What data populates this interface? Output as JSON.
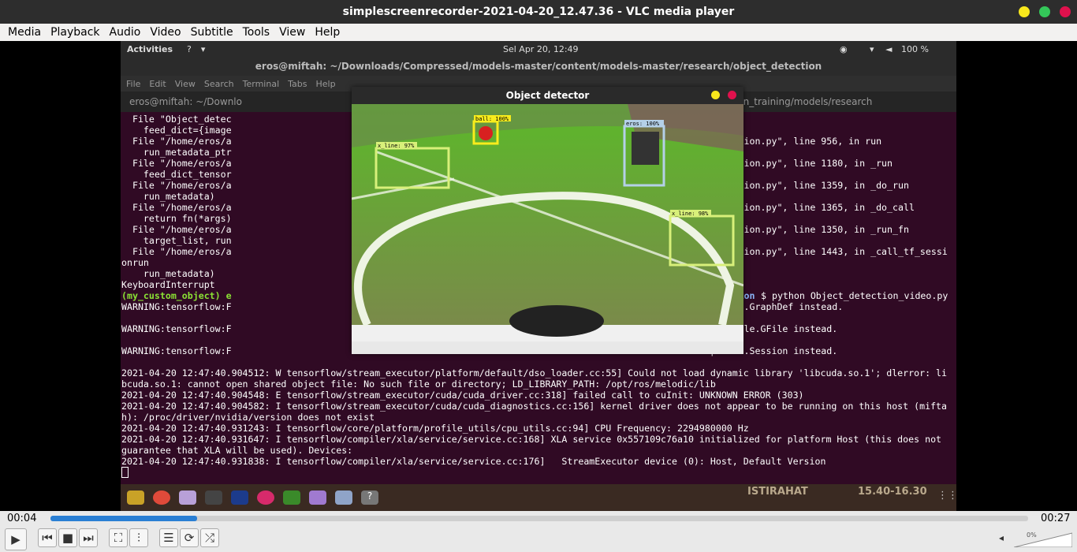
{
  "window": {
    "title": "simplescreenrecorder-2021-04-20_12.47.36 - VLC media player",
    "colors": {
      "minimize": "#f8e71c",
      "maximize": "#34c759",
      "close": "#e0114d"
    }
  },
  "menu": [
    "Media",
    "Playback",
    "Audio",
    "Video",
    "Subtitle",
    "Tools",
    "View",
    "Help"
  ],
  "desktop": {
    "activities": "Activities",
    "help": "?",
    "clock": "Sel Apr 20, 12:49",
    "battery": "100 %"
  },
  "terminal": {
    "title": "eros@miftah: ~/Downloads/Compressed/models-master/content/models-master/research/object_detection",
    "menu": [
      "File",
      "Edit",
      "View",
      "Search",
      "Terminal",
      "Tabs",
      "Help"
    ],
    "tab1": "eros@miftah: ~/Downlo",
    "tab2": "miftah: ~/code/eros_vision_training/models/research",
    "left_lines": [
      "  File \"Object_detec",
      "    feed_dict={image",
      "  File \"/home/eros/a",
      "    run_metadata_ptr",
      "  File \"/home/eros/a",
      "    feed_dict_tensor",
      "  File \"/home/eros/a",
      "    run_metadata)",
      "  File \"/home/eros/a",
      "    return fn(*args)",
      "  File \"/home/eros/a",
      "    target_list, run",
      "  File \"/home/eros/a",
      "onrun",
      "    run_metadata)",
      "KeyboardInterrupt",
      "(my_custom_object) e",
      "WARNING:tensorflow:F",
      "",
      "WARNING:tensorflow:F",
      "",
      "WARNING:tensorflow:F"
    ],
    "right_lines": [
      "",
      "",
      "ore/python/client/session.py\", line 956, in run",
      "",
      "ore/python/client/session.py\", line 1180, in _run",
      "",
      "ore/python/client/session.py\", line 1359, in _do_run",
      "",
      "ore/python/client/session.py\", line 1365, in _do_call",
      "",
      "ore/python/client/session.py\", line 1350, in _run_fn",
      "",
      "ore/python/client/session.py\", line 1443, in _call_tf_sessi",
      "",
      "",
      "",
      "esearch/object_detection",
      "lease use tf.compat.v1.GraphDef instead.",
      "",
      ". Please use tf.io.gfile.GFile instead.",
      "",
      "lease use tf.compat.v1.Session instead."
    ],
    "prompt_tail": "$ python Object_detection_video.py",
    "bottom_lines": [
      "",
      "2021-04-20 12:47:40.904512: W tensorflow/stream_executor/platform/default/dso_loader.cc:55] Could not load dynamic library 'libcuda.so.1'; dlerror: li",
      "bcuda.so.1: cannot open shared object file: No such file or directory; LD_LIBRARY_PATH: /opt/ros/melodic/lib",
      "2021-04-20 12:47:40.904548: E tensorflow/stream_executor/cuda/cuda_driver.cc:318] failed call to cuInit: UNKNOWN ERROR (303)",
      "2021-04-20 12:47:40.904582: I tensorflow/stream_executor/cuda/cuda_diagnostics.cc:156] kernel driver does not appear to be running on this host (mifta",
      "h): /proc/driver/nvidia/version does not exist",
      "2021-04-20 12:47:40.931243: I tensorflow/core/platform/profile_utils/cpu_utils.cc:94] CPU Frequency: 2294980000 Hz",
      "2021-04-20 12:47:40.931647: I tensorflow/compiler/xla/service/service.cc:168] XLA service 0x557109c76a10 initialized for platform Host (this does not",
      "guarantee that XLA will be used). Devices:",
      "2021-04-20 12:47:40.931838: I tensorflow/compiler/xla/service/service.cc:176]   StreamExecutor device (0): Host, Default Version"
    ]
  },
  "detector": {
    "title": "Object detector",
    "labels": {
      "ball": "ball: 100%",
      "eros": "eros: 100%",
      "xline1": "x_line: 97%",
      "xline2": "x_line: 98%"
    }
  },
  "wallpaper": {
    "text1": "ISTIRAHAT",
    "text2": "15.40-16.30"
  },
  "player": {
    "elapsed": "00:04",
    "total": "00:27",
    "progress": 0.15,
    "volume": "0%"
  }
}
